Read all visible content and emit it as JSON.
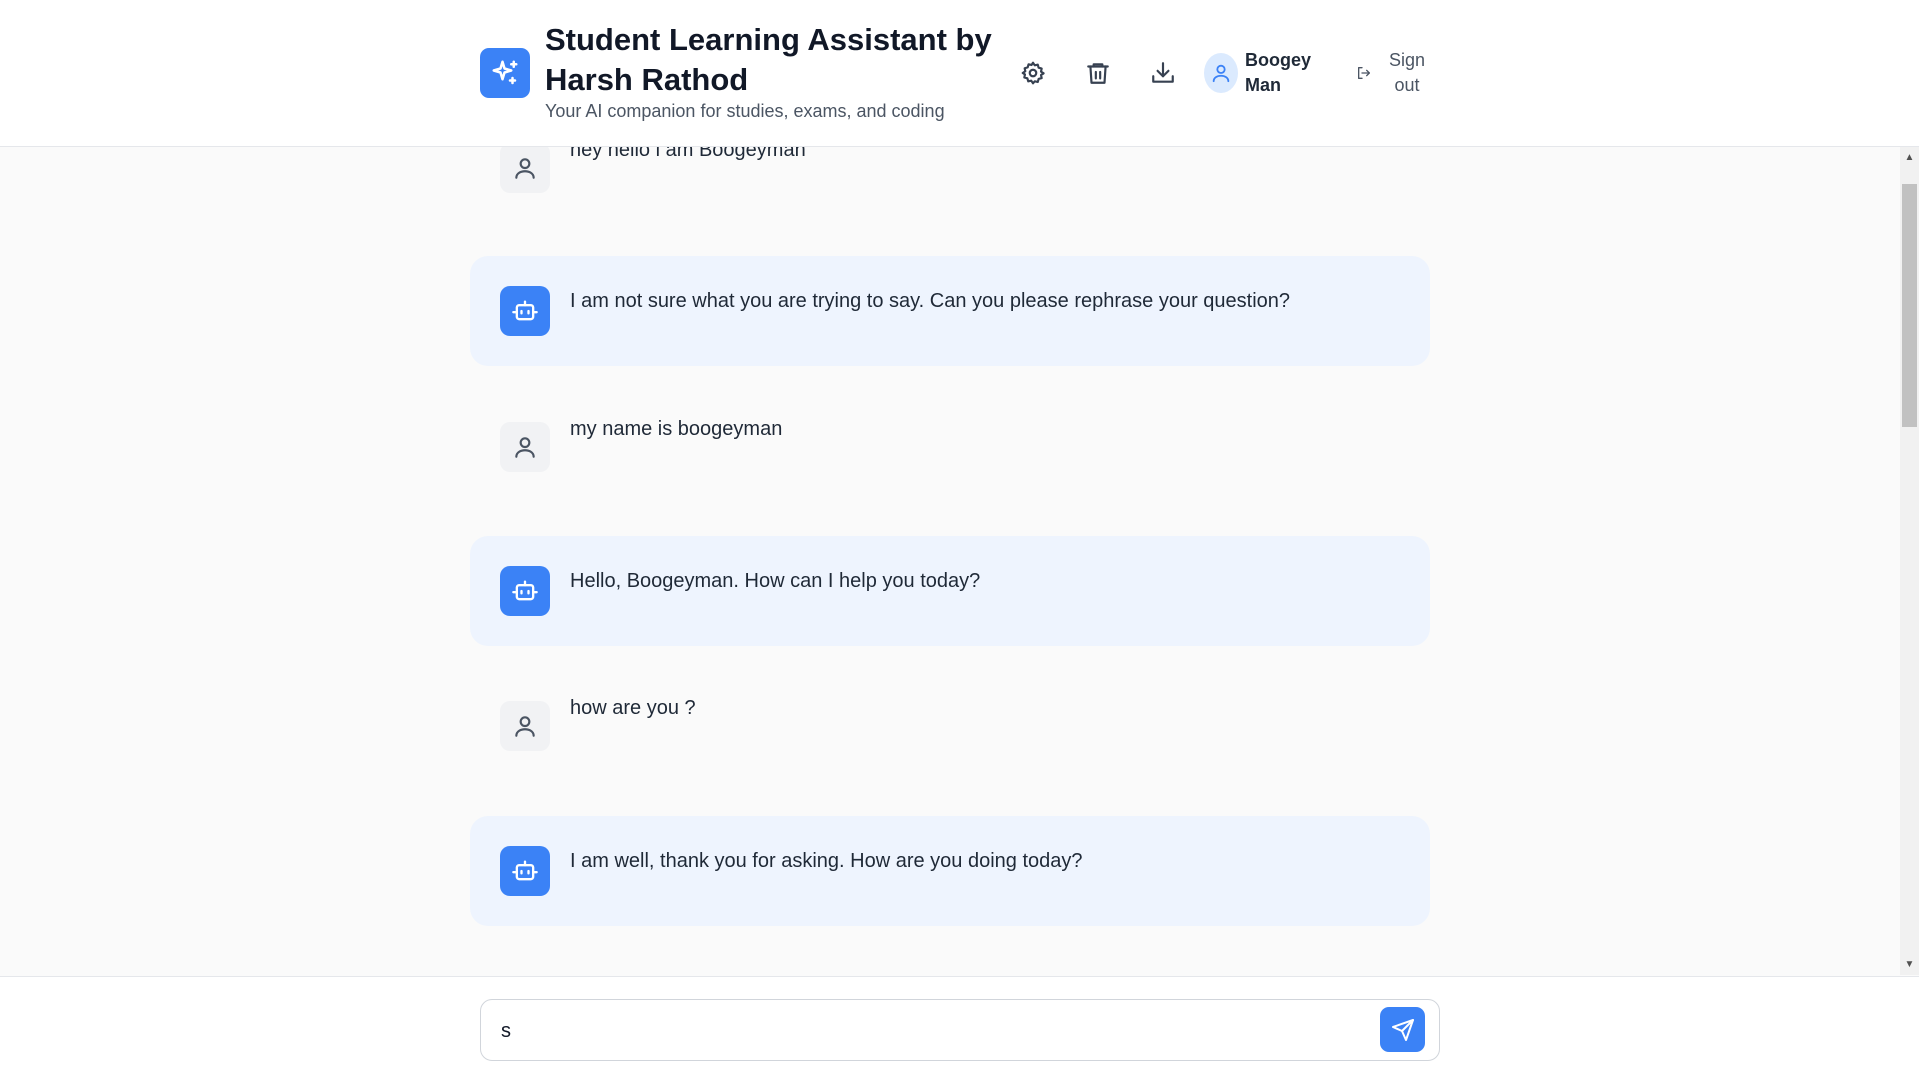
{
  "header": {
    "title": "Student Learning Assistant by Harsh Rathod",
    "subtitle": "Your AI companion for studies, exams, and coding",
    "user_name": "Boogey Man",
    "signout_label": "Sign out",
    "icons": [
      "sparkles-icon",
      "settings-icon",
      "trash-icon",
      "download-icon",
      "user-icon",
      "sign-out-icon"
    ]
  },
  "messages": [
    {
      "role": "user",
      "text": "hey hello i am Boogeyman"
    },
    {
      "role": "bot",
      "text": "I am not sure what you are trying to say. Can you please rephrase your question?"
    },
    {
      "role": "user",
      "text": "my name is boogeyman"
    },
    {
      "role": "bot",
      "text": "Hello, Boogeyman. How can I help you today?"
    },
    {
      "role": "user",
      "text": "how are you ?"
    },
    {
      "role": "bot",
      "text": "I am well, thank you for asking. How are you doing today?"
    }
  ],
  "input": {
    "value": "s",
    "placeholder": ""
  },
  "colors": {
    "accent": "#3b82f6",
    "bot_bubble": "#eef4fe",
    "user_avatar_bg": "#f1f2f4",
    "background": "#fafafa"
  }
}
